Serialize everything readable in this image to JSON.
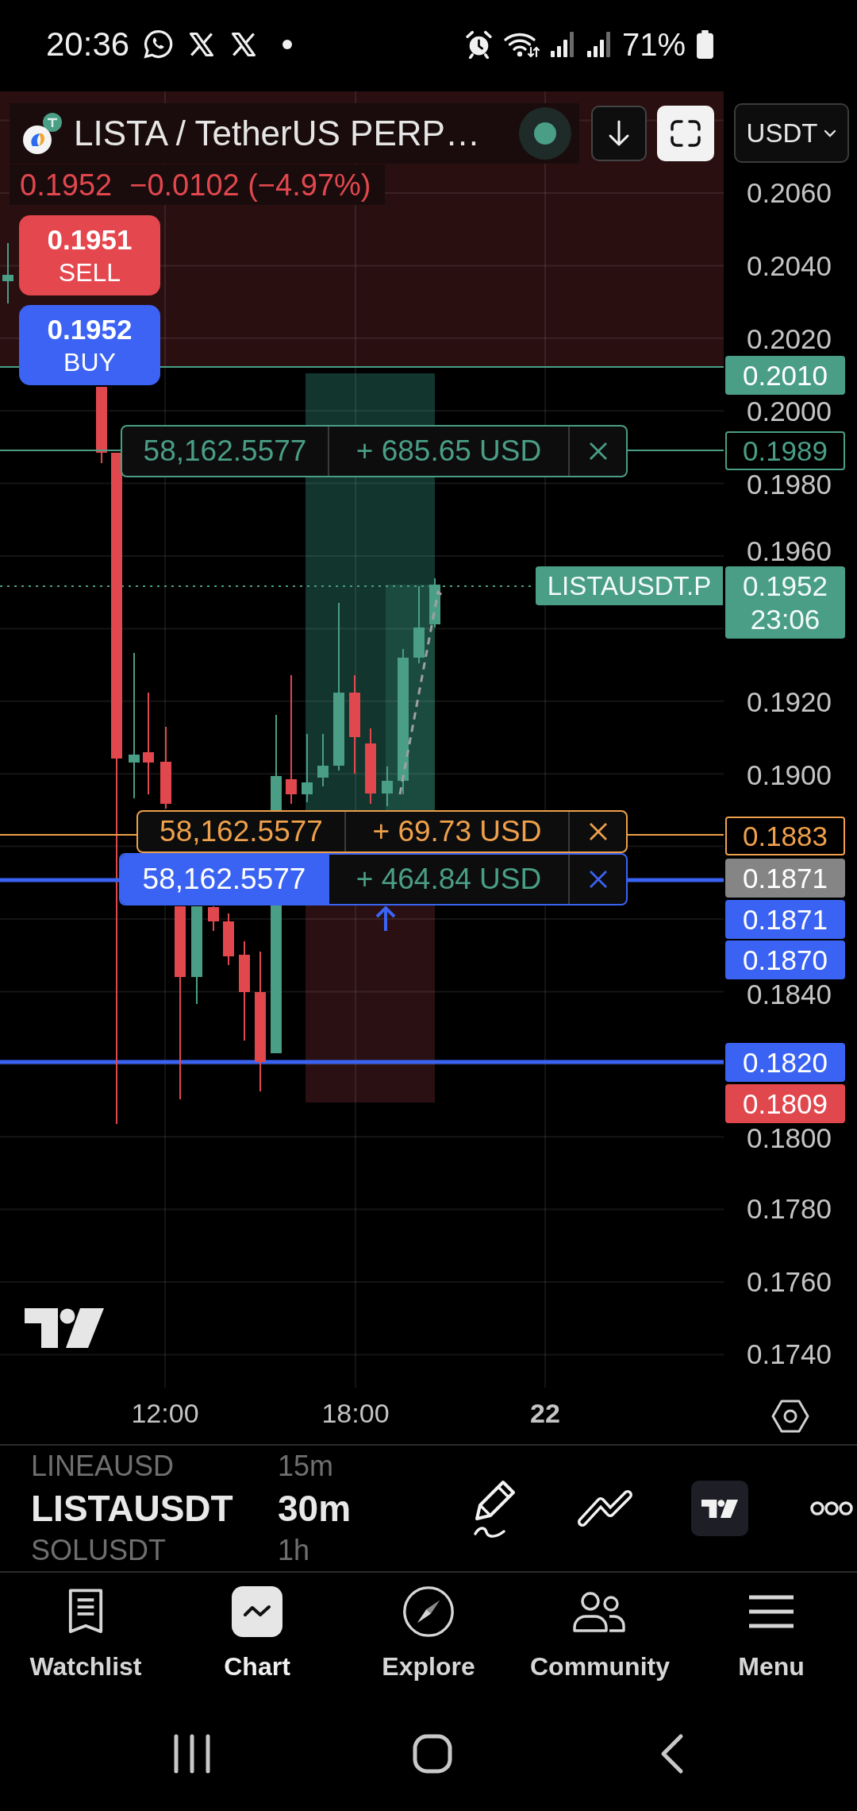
{
  "status_bar": {
    "time": "20:36",
    "battery": "71%"
  },
  "chart": {
    "header": {
      "title": "LISTA / TetherUS PERP…",
      "last": "0.1952",
      "change": "−0.0102 (−4.97%)",
      "falling": true
    },
    "currency": "USDT",
    "trade_buttons": [
      {
        "kind": "sell",
        "price": "0.1951",
        "label": "SELL"
      },
      {
        "kind": "buy",
        "price": "0.1952",
        "label": "BUY"
      }
    ],
    "orders": [
      {
        "kind": "outline",
        "color": "#4a9e86",
        "quantity": "58,162.5577",
        "pnl": "+ 685.65 USD"
      },
      {
        "kind": "outline",
        "color": "#eea04c",
        "quantity": "58,162.5577",
        "pnl": "+ 69.73 USD"
      },
      {
        "kind": "filled",
        "color": "#3b63f3",
        "quantity": "58,162.5577",
        "pnl": "+ 464.84 USD"
      }
    ],
    "last_price": {
      "symbol": "LISTAUSDT.P",
      "price": "0.1952",
      "countdown": "23:06"
    },
    "price_ticks": [
      "0.2060",
      "0.2040",
      "0.2020",
      "0.2000",
      "0.1980",
      "0.1960",
      "0.1920",
      "0.1900",
      "0.1840",
      "0.1800",
      "0.1780",
      "0.1760",
      "0.1740"
    ],
    "price_tags": [
      {
        "kind": "filled",
        "color": "#4a9e86",
        "price": "0.2010"
      },
      {
        "kind": "outline",
        "color": "#4a9e86",
        "price": "0.1989"
      },
      {
        "kind": "outline",
        "color": "#eea04c",
        "price": "0.1883"
      },
      {
        "kind": "filled",
        "color": "#858585",
        "price": "0.1871"
      },
      {
        "kind": "filled",
        "color": "#3b63f3",
        "price": "0.1871"
      },
      {
        "kind": "filled",
        "color": "#3b63f3",
        "price": "0.1870"
      },
      {
        "kind": "filled",
        "color": "#3b63f3",
        "price": "0.1820"
      },
      {
        "kind": "filled",
        "color": "#e0484e",
        "price": "0.1809"
      }
    ],
    "time_axis": [
      {
        "kind": "time",
        "label": "12:00"
      },
      {
        "kind": "time",
        "label": "18:00"
      },
      {
        "kind": "day",
        "label": "22"
      }
    ]
  },
  "toolbar": {
    "symbols": [
      {
        "symbol": "LINEAUSD",
        "interval": "15m",
        "selected": false
      },
      {
        "symbol": "LISTAUSDT",
        "interval": "30m",
        "selected": true
      },
      {
        "symbol": "SOLUSDT",
        "interval": "1h",
        "selected": false
      }
    ]
  },
  "bottom_nav": [
    {
      "label": "Watchlist",
      "selected": false
    },
    {
      "label": "Chart",
      "selected": true
    },
    {
      "label": "Explore",
      "selected": false
    },
    {
      "label": "Community",
      "selected": false
    },
    {
      "label": "Menu",
      "selected": false
    }
  ]
}
